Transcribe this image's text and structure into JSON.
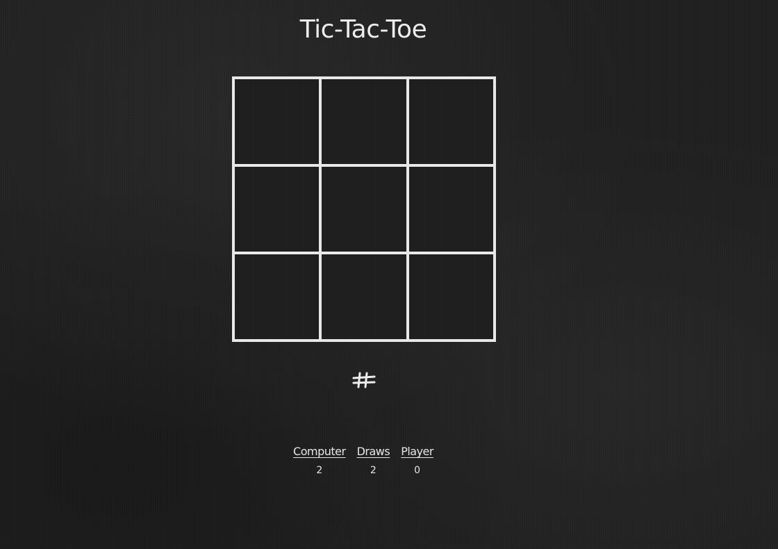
{
  "game": {
    "title": "Tic-Tac-Toe",
    "board": {
      "cells": [
        "",
        "",
        "",
        "",
        "",
        "",
        "",
        "",
        ""
      ]
    },
    "status_icon": "hash-icon"
  },
  "scoreboard": {
    "computer": {
      "label": "Computer",
      "value": "2"
    },
    "draws": {
      "label": "Draws",
      "value": "2"
    },
    "player": {
      "label": "Player",
      "value": "0"
    }
  },
  "colors": {
    "background": "#202020",
    "chalk": "#e8e8e8"
  }
}
